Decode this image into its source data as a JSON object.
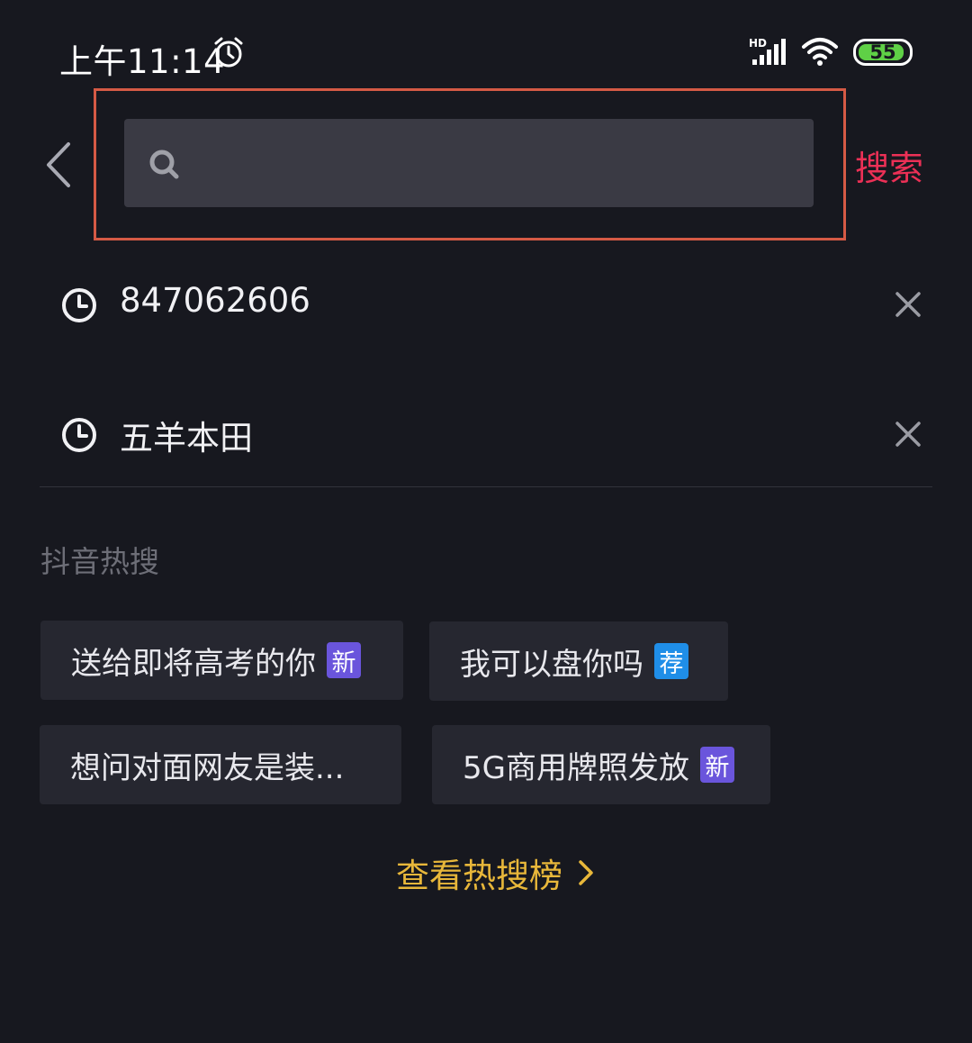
{
  "status_bar": {
    "time": "上午11:14",
    "battery_level": "55",
    "network": "HD"
  },
  "search": {
    "placeholder": "",
    "value": "",
    "button_label": "搜索"
  },
  "history": [
    {
      "text": "847062606"
    },
    {
      "text": "五羊本田"
    }
  ],
  "hot_search": {
    "title": "抖音热搜",
    "tags": [
      {
        "text": "送给即将高考的你",
        "badge": "新",
        "badge_color": "#6a55dc"
      },
      {
        "text": "我可以盘你吗",
        "badge": "荐",
        "badge_color": "#1f8ee8"
      },
      {
        "text": "想问对面网友是装...",
        "badge": "",
        "badge_color": ""
      },
      {
        "text": "5G商用牌照发放",
        "badge": "新",
        "badge_color": "#6a55dc"
      }
    ],
    "view_more_label": "查看热搜榜"
  },
  "colors": {
    "background": "#17181f",
    "search_button": "#ec3056",
    "highlight_border": "#d55a45",
    "view_more": "#e8b73a"
  }
}
